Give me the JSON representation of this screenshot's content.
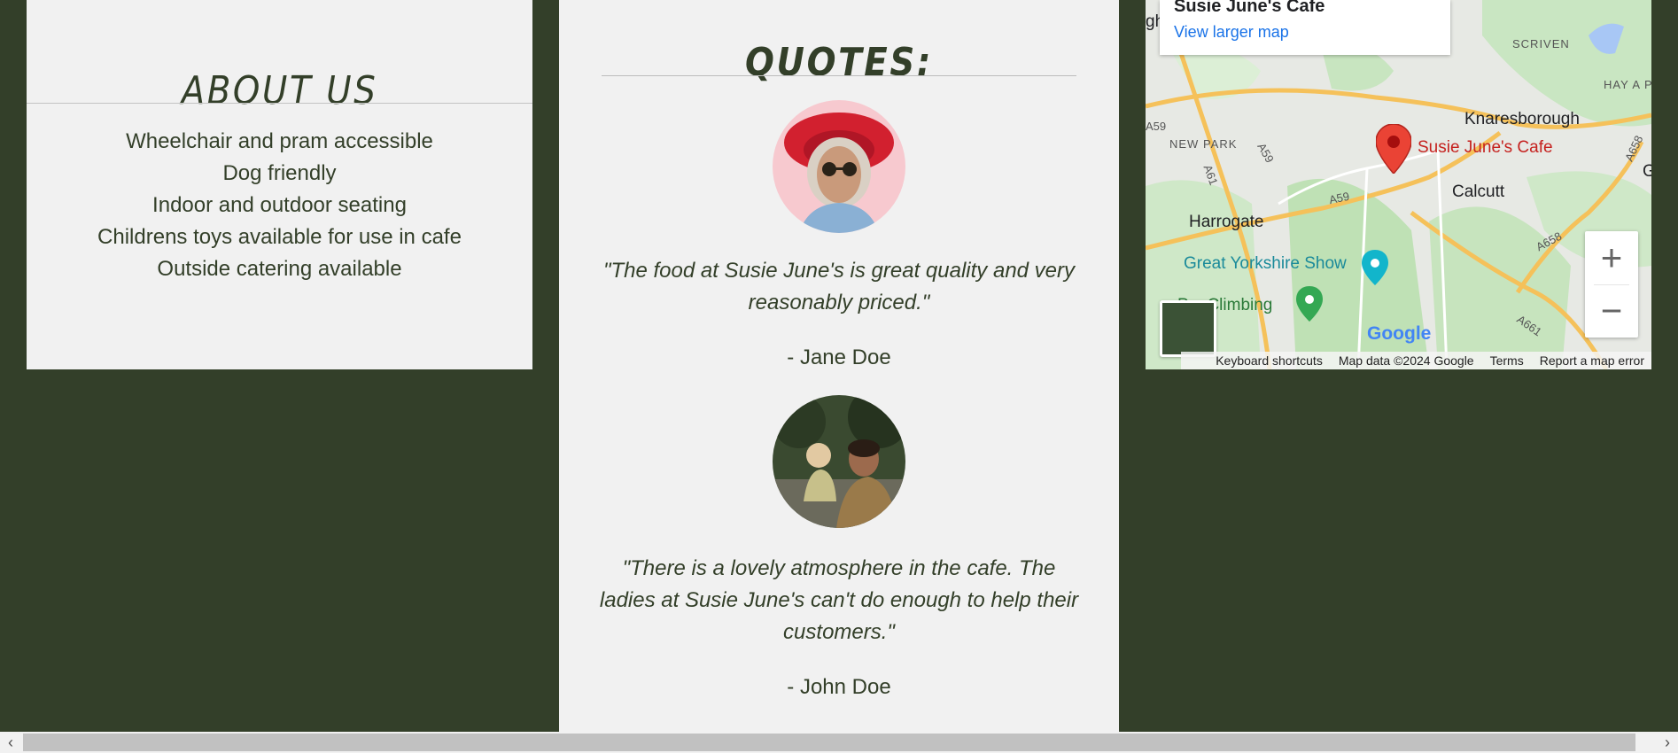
{
  "about": {
    "title": "ABOUT US",
    "items": [
      "Wheelchair and pram accessible",
      "Dog friendly",
      "Indoor and outdoor seating",
      "Childrens toys available for use in cafe",
      "Outside catering available"
    ]
  },
  "quotes": {
    "title": "QUOTES:",
    "items": [
      {
        "text": "\"The food at Susie June's is great quality and very reasonably priced.\"",
        "author": "- Jane Doe",
        "avatar_icon": "woman-red-hat-avatar"
      },
      {
        "text": "\"There is a lovely atmosphere in the cafe. The ladies at Susie June's can't do enough to help their customers.\"",
        "author": "- John Doe",
        "avatar_icon": "father-child-avatar"
      }
    ]
  },
  "map": {
    "place_name": "Susie June's Cafe",
    "larger_map_link": "View larger map",
    "marker_label": "Susie June's Cafe",
    "labels": {
      "knaresborough": "Knaresborough",
      "calcutt": "Calcutt",
      "harrogate": "Harrogate",
      "great_yorkshire_show": "Great Yorkshire Show",
      "climbing": "P    n Climbing",
      "new_park": "NEW PARK",
      "scriven": "SCRIVEN",
      "hay_a_park": "HAY A PA",
      "gh": "gh",
      "g": "G"
    },
    "roads": {
      "a59_left": "A59",
      "a59_mid": "A59",
      "a59_lower": "A59",
      "a61": "A61",
      "a658_right": "A658",
      "a658_lower": "A658",
      "a661": "A661"
    },
    "zoom_in": "+",
    "zoom_out": "−",
    "google_logo": "Google",
    "attribution": {
      "keyboard": "Keyboard shortcuts",
      "data": "Map data ©2024 Google",
      "terms": "Terms",
      "report": "Report a map error"
    }
  },
  "scrollbar": {
    "left_arrow": "‹",
    "right_arrow": "›"
  },
  "colors": {
    "background": "#333f29",
    "panel": "#f1f1f1",
    "text": "#333f29",
    "map_link": "#1a73e8",
    "marker": "#ea4335"
  }
}
